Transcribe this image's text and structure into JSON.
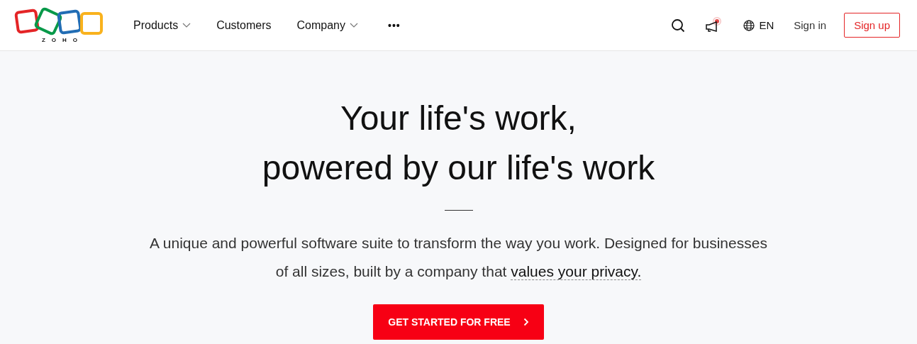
{
  "header": {
    "logo_text": "ZOHO",
    "nav": [
      {
        "label": "Products",
        "has_menu": true
      },
      {
        "label": "Customers",
        "has_menu": false
      },
      {
        "label": "Company",
        "has_menu": true
      }
    ],
    "more": "•••",
    "notification_alert": true,
    "language": "EN",
    "sign_in": "Sign in",
    "sign_up": "Sign up"
  },
  "hero": {
    "title_lines": [
      "Your life's work,",
      "powered by our life's work"
    ],
    "text": "A unique and powerful software suite to transform the way you work. Designed for businesses of all sizes, built by a company that",
    "link": "values your privacy.",
    "cta": "GET STARTED FOR FREE"
  }
}
